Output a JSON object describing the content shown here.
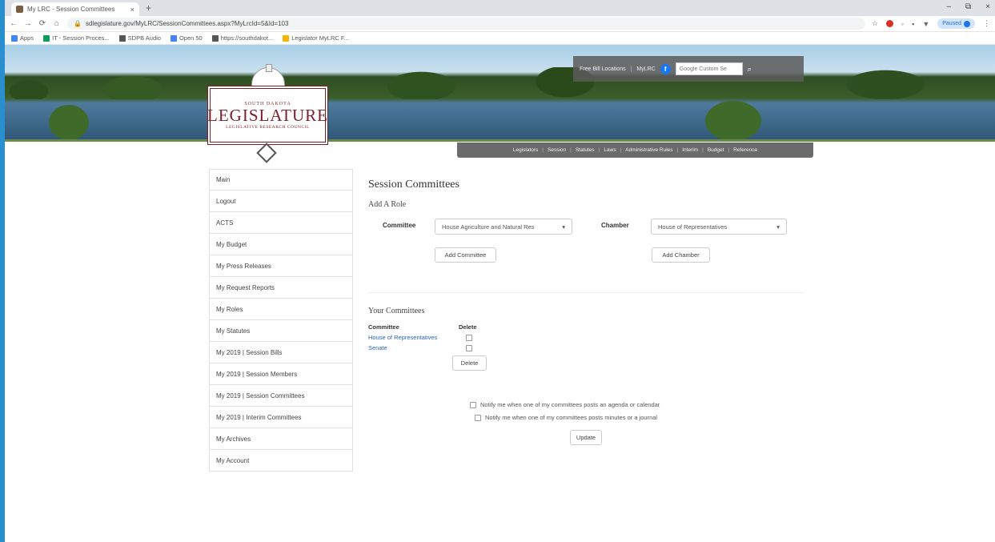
{
  "browser": {
    "tab_title": "My LRC - Session Committees",
    "tab_close": "×",
    "new_tab": "+",
    "window_controls": [
      "–",
      "⧉",
      "×"
    ],
    "nav": [
      "←",
      "→",
      "⟳",
      "⌂"
    ],
    "url": "sdlegislature.gov/MyLRC/SessionCommittees.aspx?MyLrcId=5&Id=103",
    "paused_label": "Paused",
    "bookmarks": [
      {
        "label": "Apps",
        "color": "#4285f4"
      },
      {
        "label": "IT - Session Proces...",
        "color": "#0f9d58"
      },
      {
        "label": "SDPB Audio",
        "color": "#555555"
      },
      {
        "label": "Open 50",
        "color": "#4285f4"
      },
      {
        "label": "https://southdakot...",
        "color": "#555555"
      },
      {
        "label": "Legislator MyLRC F...",
        "color": "#f4b400"
      }
    ]
  },
  "topnav": {
    "items": [
      "Free Bill Locations",
      "MyLRC"
    ],
    "sep": "|",
    "fb": "f",
    "search_placeholder": "Google Custom Se"
  },
  "logo": {
    "state": "SOUTH DAKOTA",
    "main": "LEGISLATURE",
    "sub": "LEGISLATIVE RESEARCH COUNCIL"
  },
  "mainnav": {
    "items": [
      "Legislators",
      "Session",
      "Statutes",
      "Laws",
      "Administrative Rules",
      "Interim",
      "Budget",
      "Reference"
    ],
    "sep": "|"
  },
  "sidebar": {
    "items": [
      "Main",
      "Logout",
      "ACTS",
      "My Budget",
      "My Press Releases",
      "My Request Reports",
      "My Roles",
      "My Statutes",
      "My 2019 | Session Bills",
      "My 2019 | Session Members",
      "My 2019 | Session Committees",
      "My 2019 | Interim Committees",
      "My Archives",
      "My Account"
    ]
  },
  "content": {
    "title": "Session Committees",
    "add_role": "Add A Role",
    "committee_label": "Committee",
    "committee_value": "House Agriculture and Natural Res",
    "chamber_label": "Chamber",
    "chamber_value": "House of Representatives",
    "add_committee": "Add Committee",
    "add_chamber": "Add Chamber",
    "your_title": "Your Committees",
    "col_committee": "Committee",
    "col_delete": "Delete",
    "rows": [
      "House of Representatives",
      "Senate"
    ],
    "delete_btn": "Delete",
    "notify1": "Notify me when one of my committees posts an agenda or calendar",
    "notify2": "Notify me when one of my committees posts minutes or a journal",
    "update_btn": "Update"
  }
}
